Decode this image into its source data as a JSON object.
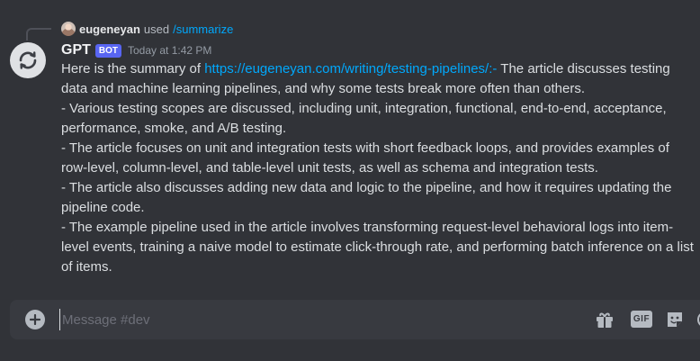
{
  "reply": {
    "username": "eugeneyan",
    "used_text": "used",
    "command": "/summarize"
  },
  "message": {
    "author": "GPT",
    "badge": "BOT",
    "timestamp": "Today at 1:42 PM",
    "intro_before_link": "Here is the summary of ",
    "link_text": "https://eugeneyan.com/writing/testing-pipelines/:-",
    "intro_after_link": " The article discusses testing data and machine learning pipelines, and why some tests break more often than others.",
    "points": [
      "- Various testing scopes are discussed, including unit, integration, functional, end-to-end, acceptance, performance, smoke, and A/B testing.",
      "- The article focuses on unit and integration tests with short feedback loops, and provides examples of row-level, column-level, and table-level unit tests, as well as schema and integration tests.",
      "- The article also discusses adding new data and logic to the pipeline, and how it requires updating the pipeline code.",
      "- The example pipeline used in the article involves transforming request-level behavioral logs into item-level events, training a naive model to estimate click-through rate, and performing batch inference on a list of items."
    ]
  },
  "composer": {
    "placeholder": "Message #dev",
    "value": "",
    "gif_label": "GIF"
  },
  "icons": {
    "reply_avatar": "user-avatar-icon",
    "bot_avatar": "refresh-arrows-icon",
    "attach": "plus-circle-icon",
    "gift": "gift-icon",
    "sticker": "sticker-icon",
    "emoji": "emoji-icon"
  },
  "colors": {
    "background": "#313338",
    "link": "#00a8fc",
    "badge": "#5865f2",
    "composer": "#383a40"
  }
}
